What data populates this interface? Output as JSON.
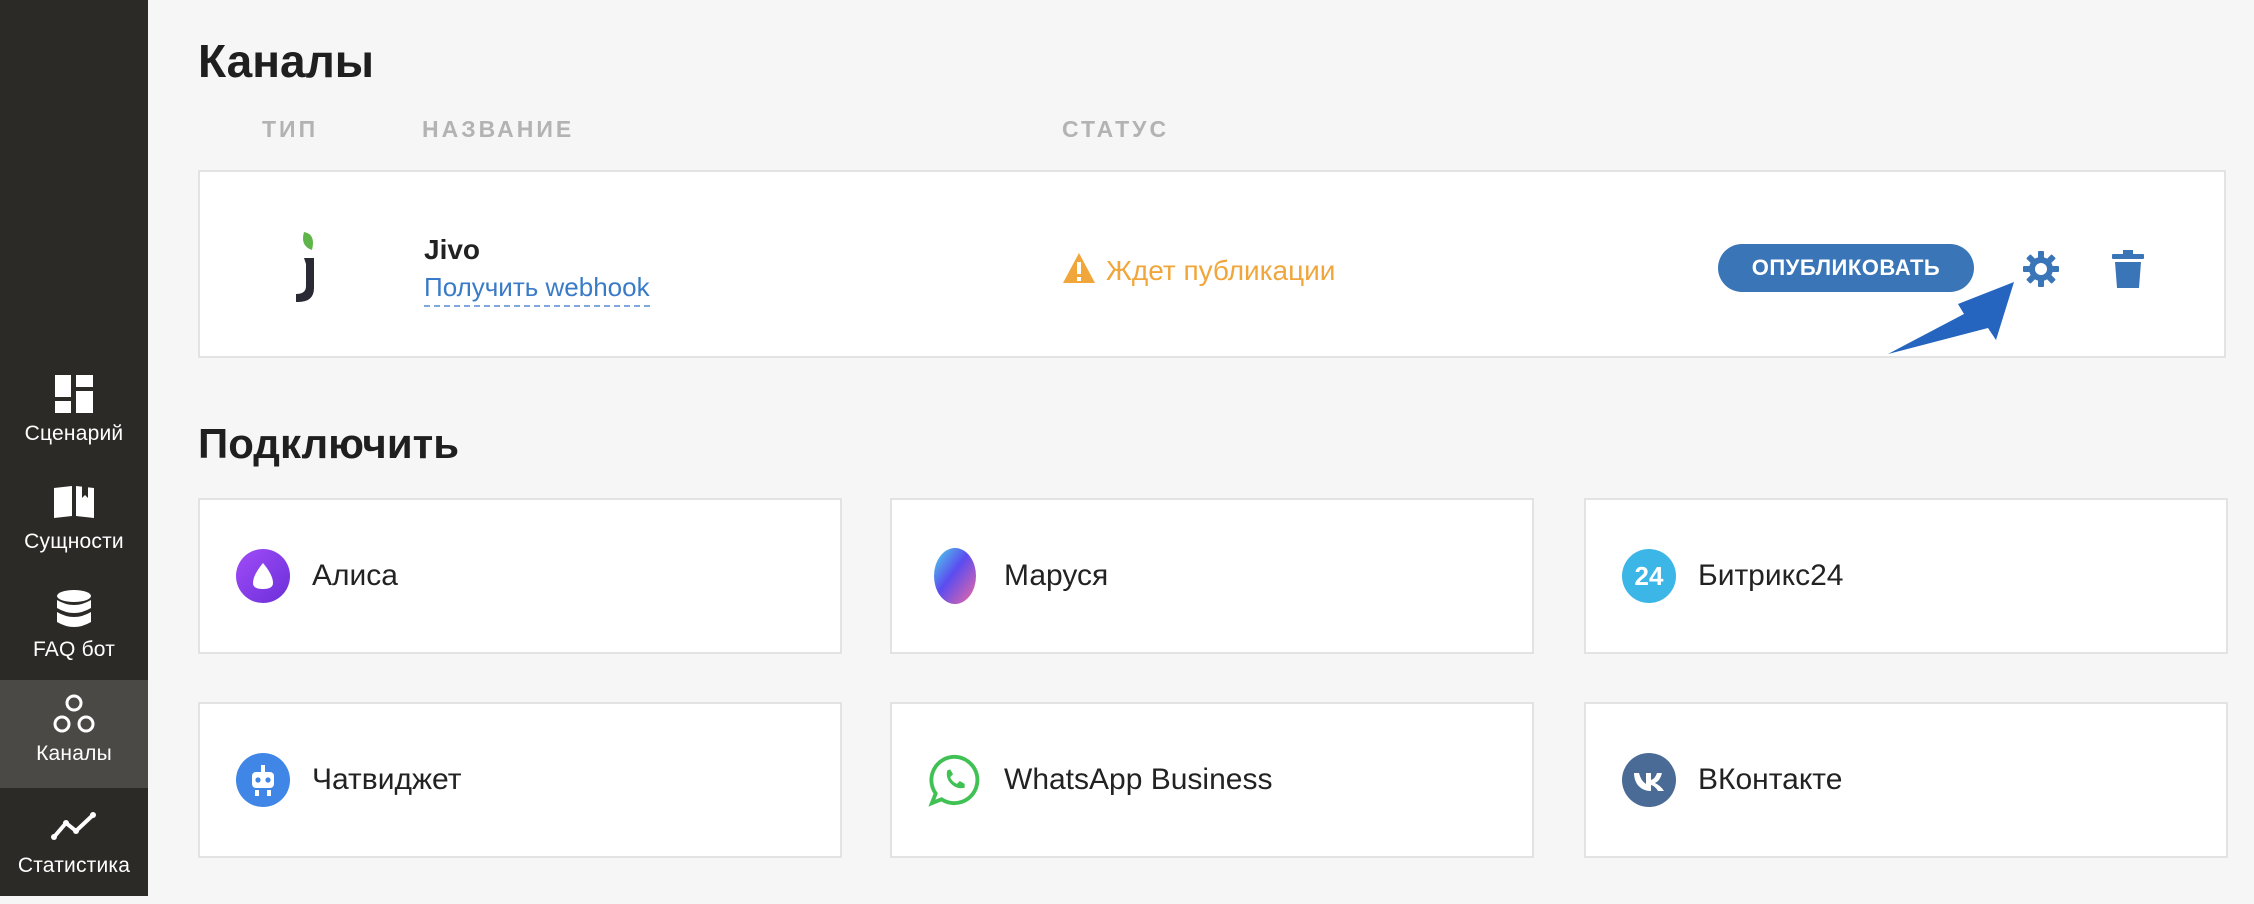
{
  "sidebar": {
    "items": [
      {
        "label": "Сценарий",
        "icon": "dashboard-icon"
      },
      {
        "label": "Сущности",
        "icon": "book-icon"
      },
      {
        "label": "FAQ бот",
        "icon": "database-icon"
      },
      {
        "label": "Каналы",
        "icon": "channels-icon",
        "active": true
      },
      {
        "label": "Статистика",
        "icon": "chart-line-icon"
      }
    ]
  },
  "page": {
    "title": "Каналы",
    "columns": [
      "ТИП",
      "НАЗВАНИЕ",
      "СТАТУС"
    ]
  },
  "channel": {
    "name": "Jivo",
    "link": "Получить webhook",
    "status": "Ждет публикации",
    "publish_label": "ОПУБЛИКОВАТЬ",
    "status_color": "#f0a63a"
  },
  "connect": {
    "title": "Подключить",
    "items": [
      {
        "label": "Алиса",
        "icon": "alice-icon"
      },
      {
        "label": "Маруся",
        "icon": "marusya-icon"
      },
      {
        "label": "Битрикс24",
        "icon": "bitrix24-icon",
        "icon_text": "24"
      },
      {
        "label": "Чатвиджет",
        "icon": "chat-widget-icon"
      },
      {
        "label": "WhatsApp Business",
        "icon": "whatsapp-icon"
      },
      {
        "label": "ВКонтакте",
        "icon": "vk-icon"
      }
    ]
  },
  "colors": {
    "sidebar_bg": "#2b2a27",
    "accent": "#3a75b8",
    "warning": "#f0a63a"
  }
}
